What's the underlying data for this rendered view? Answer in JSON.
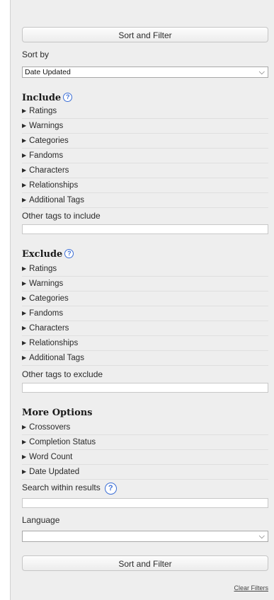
{
  "buttons": {
    "top": "Sort and Filter",
    "bottom": "Sort and Filter"
  },
  "sort": {
    "label": "Sort by",
    "value": "Date Updated"
  },
  "include": {
    "heading": "Include",
    "items": [
      "Ratings",
      "Warnings",
      "Categories",
      "Fandoms",
      "Characters",
      "Relationships",
      "Additional Tags"
    ],
    "other_label": "Other tags to include"
  },
  "exclude": {
    "heading": "Exclude",
    "items": [
      "Ratings",
      "Warnings",
      "Categories",
      "Fandoms",
      "Characters",
      "Relationships",
      "Additional Tags"
    ],
    "other_label": "Other tags to exclude"
  },
  "more": {
    "heading": "More Options",
    "items": [
      "Crossovers",
      "Completion Status",
      "Word Count",
      "Date Updated"
    ],
    "search_label": "Search within results",
    "language_label": "Language",
    "language_value": ""
  },
  "help_glyph": "?",
  "chevron": "⌵",
  "triangle": "▶",
  "clear_filters": "Clear Filters",
  "colors": {
    "panel_bg": "#eeeeee",
    "help_blue": "#3b6ed6"
  }
}
